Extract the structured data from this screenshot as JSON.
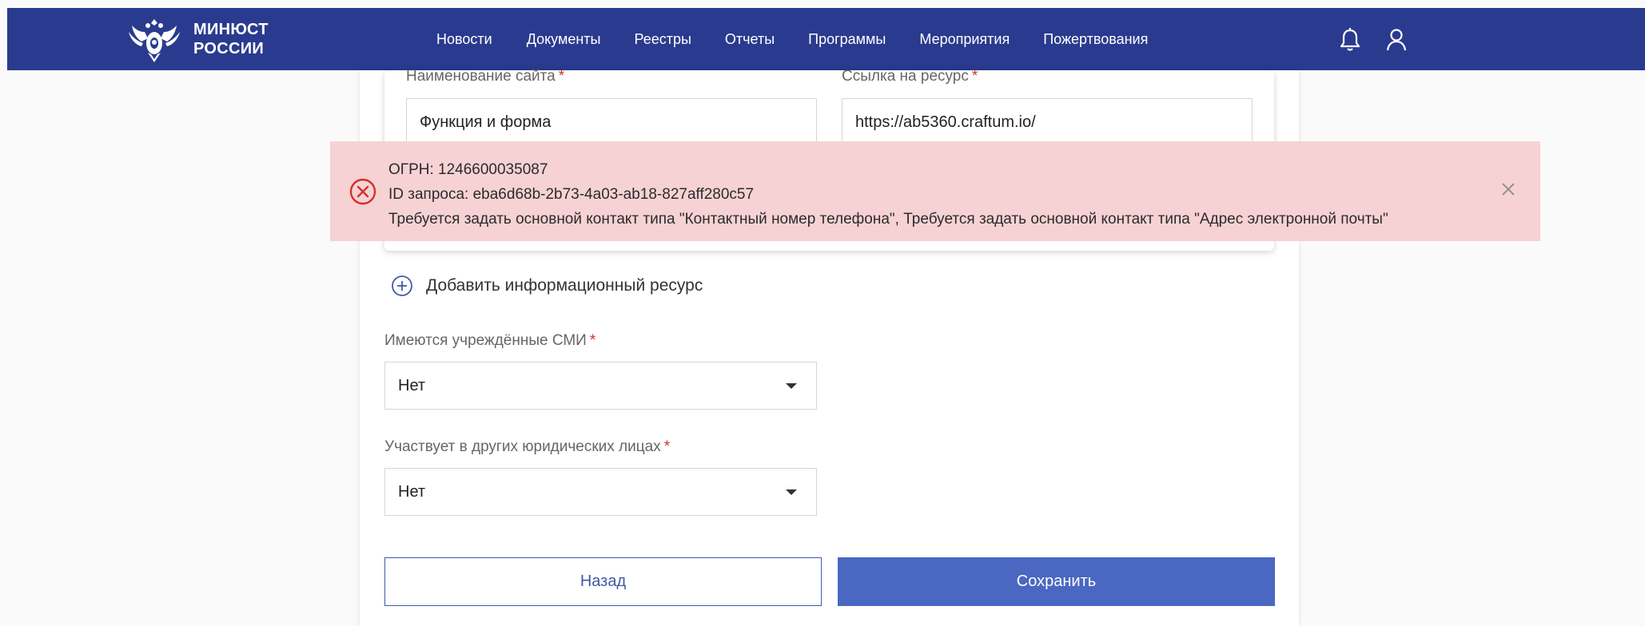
{
  "header": {
    "logo_line1": "МИНЮСТ",
    "logo_line2": "РОССИИ",
    "nav": [
      "Новости",
      "Документы",
      "Реестры",
      "Отчеты",
      "Программы",
      "Мероприятия",
      "Пожертвования"
    ],
    "bell_icon": "bell-icon",
    "user_icon": "user-icon"
  },
  "resource": {
    "site_name_label": "Наименование сайта",
    "site_name_value": "Функция и форма",
    "link_label": "Ссылка на ресурс",
    "link_value": "https://ab5360.craftum.io/",
    "required_mark": "*"
  },
  "alert": {
    "ogrn": "ОГРН: 1246600035087",
    "request_id": "ID запроса: eba6d68b-2b73-4a03-ab18-827aff280c57",
    "message": "Требуется задать основной контакт типа \"Контактный номер телефона\", Требуется задать основной контакт типа \"Адрес электронной почты\""
  },
  "add_resource_label": "Добавить информационный ресурс",
  "fields": {
    "media_label": "Имеются учреждённые СМИ",
    "media_value": "Нет",
    "other_entities_label": "Участвует в других юридических лицах",
    "other_entities_value": "Нет"
  },
  "buttons": {
    "back": "Назад",
    "save": "Сохранить"
  },
  "colors": {
    "header_bg": "#2a3b8f",
    "alert_bg": "#f6d2d4",
    "error_red": "#d32f2f",
    "primary": "#4a67c2"
  }
}
